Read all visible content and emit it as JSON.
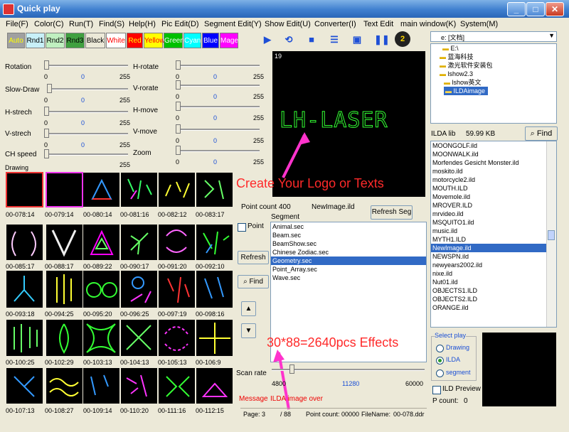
{
  "window": {
    "title": "Quick play",
    "minimize": "_",
    "maximize": "□",
    "close": "✕"
  },
  "menu": [
    "File(F)",
    "Color(C)",
    "Run(T)",
    "Find(S)",
    "Help(H)",
    "Pic Edit(D)",
    "Segment Edit(Y)",
    "Show Edit(U)",
    "Converter(I)",
    "Text Edit",
    "main window(K)",
    "System(M)"
  ],
  "colors": [
    {
      "label": "Auto",
      "bg": "#a0a0a0",
      "fg": "#ffff00"
    },
    {
      "label": "Rnd1",
      "bg": "#c8f0f8",
      "fg": "#000000"
    },
    {
      "label": "Rnd2",
      "bg": "#c0f0c0",
      "fg": "#000000"
    },
    {
      "label": "Rnd3",
      "bg": "#40a040",
      "fg": "#000000"
    },
    {
      "label": "Black",
      "bg": "#ece9d8",
      "fg": "#000000"
    },
    {
      "label": "White",
      "bg": "#ffffff",
      "fg": "#ff0000"
    },
    {
      "label": "Red",
      "bg": "#ff0000",
      "fg": "#ffff00"
    },
    {
      "label": "Yellow",
      "bg": "#ffff00",
      "fg": "#ff0000"
    },
    {
      "label": "Green",
      "bg": "#00c000",
      "fg": "#ffffff"
    },
    {
      "label": "Cyan",
      "bg": "#00ffff",
      "fg": "#ffffff"
    },
    {
      "label": "Blue",
      "bg": "#0000ff",
      "fg": "#ffffff"
    },
    {
      "label": "Mage",
      "bg": "#ff00ff",
      "fg": "#ffffff"
    }
  ],
  "sliders_left": [
    {
      "label": "Rotation",
      "min": "0",
      "mid": "0",
      "max": "255"
    },
    {
      "label": "Slow-Draw",
      "min": "0",
      "mid": "0",
      "max": "255"
    },
    {
      "label": "H-strech",
      "min": "0",
      "mid": "0",
      "max": "255"
    },
    {
      "label": "V-strech",
      "min": "0",
      "mid": "0",
      "max": "255"
    },
    {
      "label": "CH speed",
      "min": "Drawing",
      "mid": "",
      "max": "255"
    }
  ],
  "sliders_right": [
    {
      "label": "H-rotate",
      "min": "0",
      "mid": "0",
      "max": "255"
    },
    {
      "label": "V-rorate",
      "min": "0",
      "mid": "0",
      "max": "255"
    },
    {
      "label": "H-move",
      "min": "0",
      "mid": "0",
      "max": "255"
    },
    {
      "label": "V-move",
      "min": "0",
      "mid": "0",
      "max": "255"
    },
    {
      "label": "Zoom",
      "min": "0",
      "mid": "0",
      "max": "255"
    }
  ],
  "preview": {
    "number": "19",
    "logo": "LH-LASER",
    "caption": "Create Your Logo or Texts"
  },
  "grid_captions": [
    [
      "00-078:14",
      "00-079:14",
      "00-080:14",
      "00-081:16",
      "00-082:12",
      "00-083:17"
    ],
    [
      "00-085:17",
      "00-088:17",
      "00-089:22",
      "00-090:17",
      "00-091:20",
      "00-092:10"
    ],
    [
      "00-093:18",
      "00-094:25",
      "00-095:20",
      "00-096:25",
      "00-097:19",
      "00-098:16"
    ],
    [
      "00-100:25",
      "00-102:29",
      "00-103:13",
      "00-104:13",
      "00-105:13",
      "00-106:9"
    ],
    [
      "00-107:13",
      "00-108:27",
      "00-109:14",
      "00-110:20",
      "00-111:16",
      "00-112:15"
    ]
  ],
  "middle": {
    "point_count_label": "Point count",
    "point_count_value": "400",
    "file": "NewImage.ild",
    "refresh_seg": "Refresh Seg",
    "segment_label": "Segment",
    "point_check": "Point",
    "refresh": "Refresh",
    "find": "Find",
    "up": "▲",
    "down": "▼",
    "segments": [
      "Animal.sec",
      "Beam.sec",
      "BeamShow.sec",
      "Chinese Zodiac.sec",
      "Geometry.sec",
      "Point_Array.sec",
      "Wave.sec"
    ],
    "selected_segment": "Geometry.sec",
    "effects": "30*88=2640pcs Effects",
    "scan_rate_label": "Scan rate",
    "scan_min": "4800",
    "scan_mid": "11280",
    "scan_max": "60000",
    "message_label": "Message",
    "message_text": "ILDA image over"
  },
  "status": {
    "page": "Page: 3",
    "total": "/ 88",
    "point_count": "Point count: 00000",
    "filename": "FileName:",
    "filename_value": "00-078.ddr"
  },
  "right": {
    "drive": "e: [文档]",
    "tree": [
      "E:\\",
      "蓝海科技",
      "激光软件安装包",
      "lshow2.3",
      "lshow英文",
      "ILDAimage"
    ],
    "ilda_lib": "ILDA lib",
    "size": "59.99 KB",
    "find": "Find",
    "files": [
      "MOONGOLF.ild",
      "MOONWALK.ild",
      "Morfendes Gesicht Monster.ild",
      "moskito.ild",
      "motorcycle2.ild",
      "MOUTH.ILD",
      "Movemole.ild",
      "MROVER.ILD",
      "mrvideo.ild",
      "MSQUITO1.ild",
      "music.ild",
      "MYTH1.ILD",
      "NewImage.ild",
      "NEWSPN.ild",
      "newyears2002.ild",
      "nixe.ild",
      "Nut01.ild",
      "OBJECTS1.ILD",
      "OBJECTS2.ILD",
      "ORANGE.ild"
    ],
    "selected_file": "NewImage.ild",
    "select_play": "Select play",
    "opt_drawing": "Drawing",
    "opt_ilda": "ILDA",
    "opt_segment": "segment",
    "ild_preview": "ILD Preview",
    "p_count": "P count:",
    "p_count_value": "0"
  }
}
